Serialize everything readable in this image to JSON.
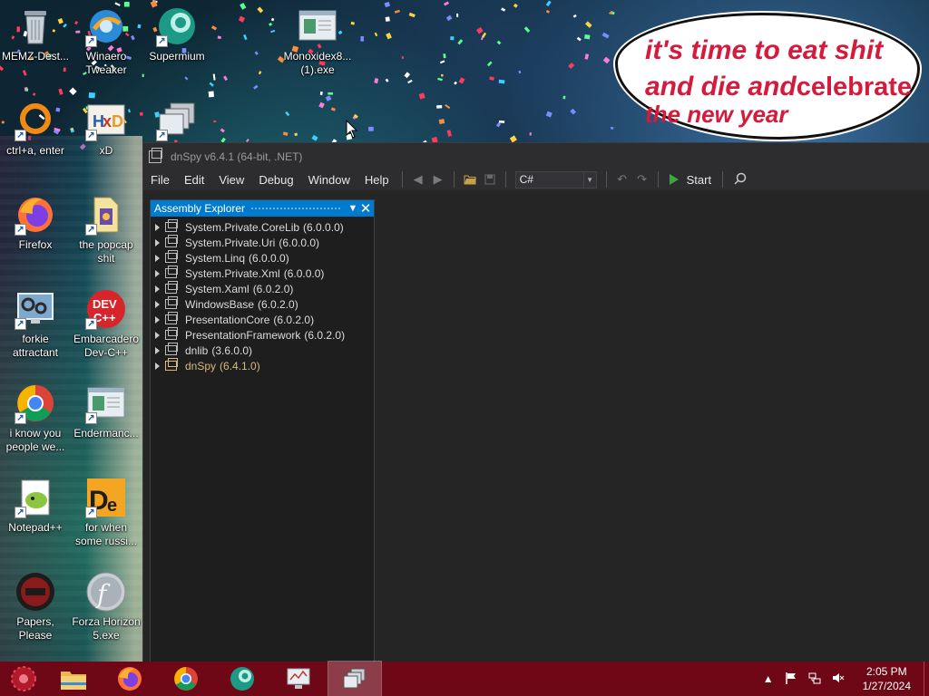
{
  "desktop": {
    "icons": [
      {
        "label": "MEMZ-Dest...",
        "icon": "recycle-bin-icon"
      },
      {
        "label": "Winaero\nTweaker",
        "icon": "winaero-tweaker-icon"
      },
      {
        "label": "Supermium",
        "icon": "supermium-icon"
      },
      {
        "label": "Monoxidex8...\n(1).exe",
        "icon": "exe-window-icon"
      },
      {
        "label": "ctrl+a, enter",
        "icon": "orange-ring-icon"
      },
      {
        "label": "xD",
        "icon": "hxd-icon"
      },
      {
        "label": "Firefox",
        "icon": "firefox-icon"
      },
      {
        "label": "the popcap\nshit",
        "icon": "popcap-icon"
      },
      {
        "label": "forkie\nattractant",
        "icon": "gear-monitor-icon"
      },
      {
        "label": "Embarcadero\nDev-C++",
        "icon": "devcpp-icon"
      },
      {
        "label": "i know you\npeople we...",
        "icon": "chrome-icon"
      },
      {
        "label": "Endermanc...",
        "icon": "exe-window-icon"
      },
      {
        "label": "Notepad++",
        "icon": "notepadpp-icon"
      },
      {
        "label": "for when\nsome russi...",
        "icon": "de-icon"
      },
      {
        "label": "Papers, Please",
        "icon": "papers-please-icon"
      },
      {
        "label": "Forza Horizon\n5.exe",
        "icon": "flash-icon"
      }
    ],
    "bubble": {
      "line1": "it's time to eat shit",
      "line2a": "and die and",
      "line2b": "celebrate",
      "line3": "the new year"
    }
  },
  "dnspy": {
    "title": "dnSpy v6.4.1 (64-bit, .NET)",
    "menu": [
      "File",
      "Edit",
      "View",
      "Debug",
      "Window",
      "Help"
    ],
    "language": "C#",
    "start_label": "Start",
    "assembly_explorer": {
      "title": "Assembly Explorer",
      "items": [
        {
          "name": "System.Private.CoreLib",
          "version": "(6.0.0.0)"
        },
        {
          "name": "System.Private.Uri",
          "version": "(6.0.0.0)"
        },
        {
          "name": "System.Linq",
          "version": "(6.0.0.0)"
        },
        {
          "name": "System.Private.Xml",
          "version": "(6.0.0.0)"
        },
        {
          "name": "System.Xaml",
          "version": "(6.0.2.0)"
        },
        {
          "name": "WindowsBase",
          "version": "(6.0.2.0)"
        },
        {
          "name": "PresentationCore",
          "version": "(6.0.2.0)"
        },
        {
          "name": "PresentationFramework",
          "version": "(6.0.2.0)"
        },
        {
          "name": "dnlib",
          "version": "(3.6.0.0)"
        },
        {
          "name": "dnSpy",
          "version": "(6.4.1.0)",
          "highlight": true
        }
      ]
    }
  },
  "taskbar": {
    "apps": [
      "file-explorer",
      "firefox",
      "chrome",
      "supermium",
      "monitor",
      "dnspy"
    ],
    "active_app": "dnspy",
    "time": "2:05 PM",
    "date": "1/27/2024"
  },
  "colors": {
    "taskbar": "#6e0716",
    "panel_header": "#007acc",
    "window_bg": "#252526",
    "bubble_text": "#d61a3c"
  }
}
